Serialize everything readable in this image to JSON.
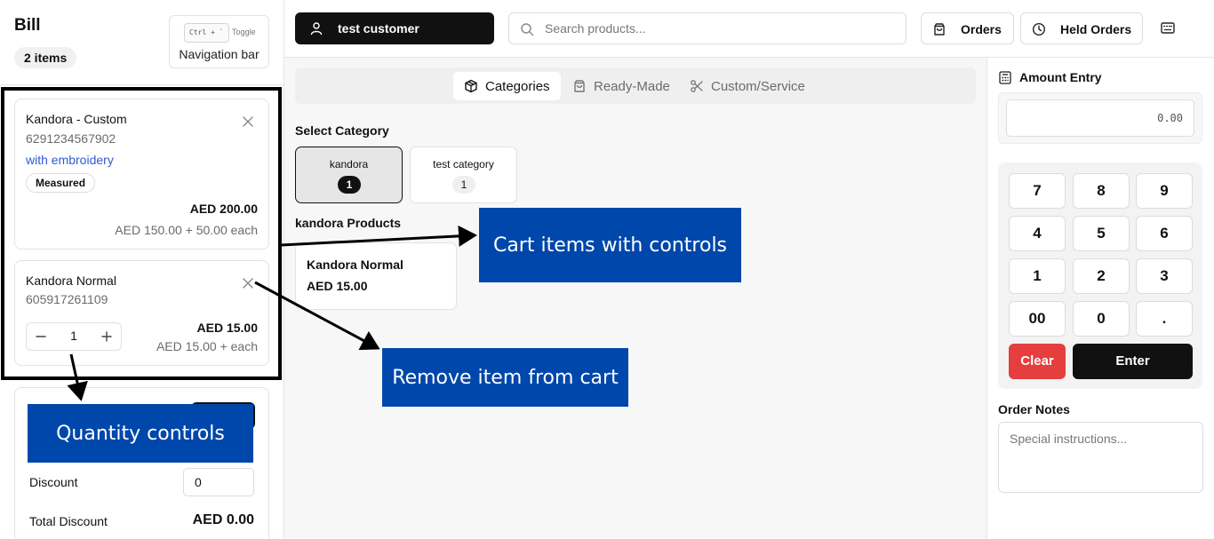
{
  "bill": {
    "title": "Bill",
    "item_count": "2 items",
    "nav_toggle": {
      "kbd": "Ctrl + `",
      "toggle": "Toggle",
      "label": "Navigation bar"
    }
  },
  "cart": {
    "items": [
      {
        "name": "Kandora - Custom",
        "code": "6291234567902",
        "note": "with embroidery",
        "badge": "Measured",
        "total": "AED 200.00",
        "breakdown": "AED 150.00 + 50.00 each"
      },
      {
        "name": "Kandora Normal",
        "code": "605917261109",
        "quantity": "1",
        "total": "AED 15.00",
        "breakdown": "AED 15.00 + each"
      }
    ]
  },
  "summary": {
    "discount_label": "Discount",
    "discount_value": "0",
    "total_discount_label": "Total Discount",
    "total_discount_value": "AED 0.00"
  },
  "topbar": {
    "customer": "test customer",
    "search_placeholder": "Search products...",
    "orders": "Orders",
    "held_orders": "Held Orders"
  },
  "tabs": [
    {
      "label": "Categories",
      "active": true
    },
    {
      "label": "Ready-Made",
      "active": false
    },
    {
      "label": "Custom/Service",
      "active": false
    }
  ],
  "catalog": {
    "select_category_title": "Select Category",
    "categories": [
      {
        "name": "kandora",
        "count": "1",
        "selected": true
      },
      {
        "name": "test category",
        "count": "1",
        "selected": false
      }
    ],
    "products_title": "kandora Products",
    "products": [
      {
        "name": "Kandora Normal",
        "price": "AED 15.00"
      }
    ]
  },
  "amount_entry": {
    "title": "Amount Entry",
    "value": "0.00",
    "keys": [
      "7",
      "8",
      "9",
      "4",
      "5",
      "6",
      "1",
      "2",
      "3",
      "00",
      "0",
      "."
    ],
    "clear": "Clear",
    "enter": "Enter"
  },
  "notes": {
    "title": "Order Notes",
    "placeholder": "Special instructions..."
  },
  "annotations": {
    "cart_items": "Cart items with controls",
    "remove_item": "Remove item from cart",
    "quantity": "Quantity controls"
  },
  "colors": {
    "accent_dark": "#111111",
    "link_blue": "#2f5bd3",
    "clear_red": "#e53e3e",
    "annotation_blue": "#0047ab"
  }
}
